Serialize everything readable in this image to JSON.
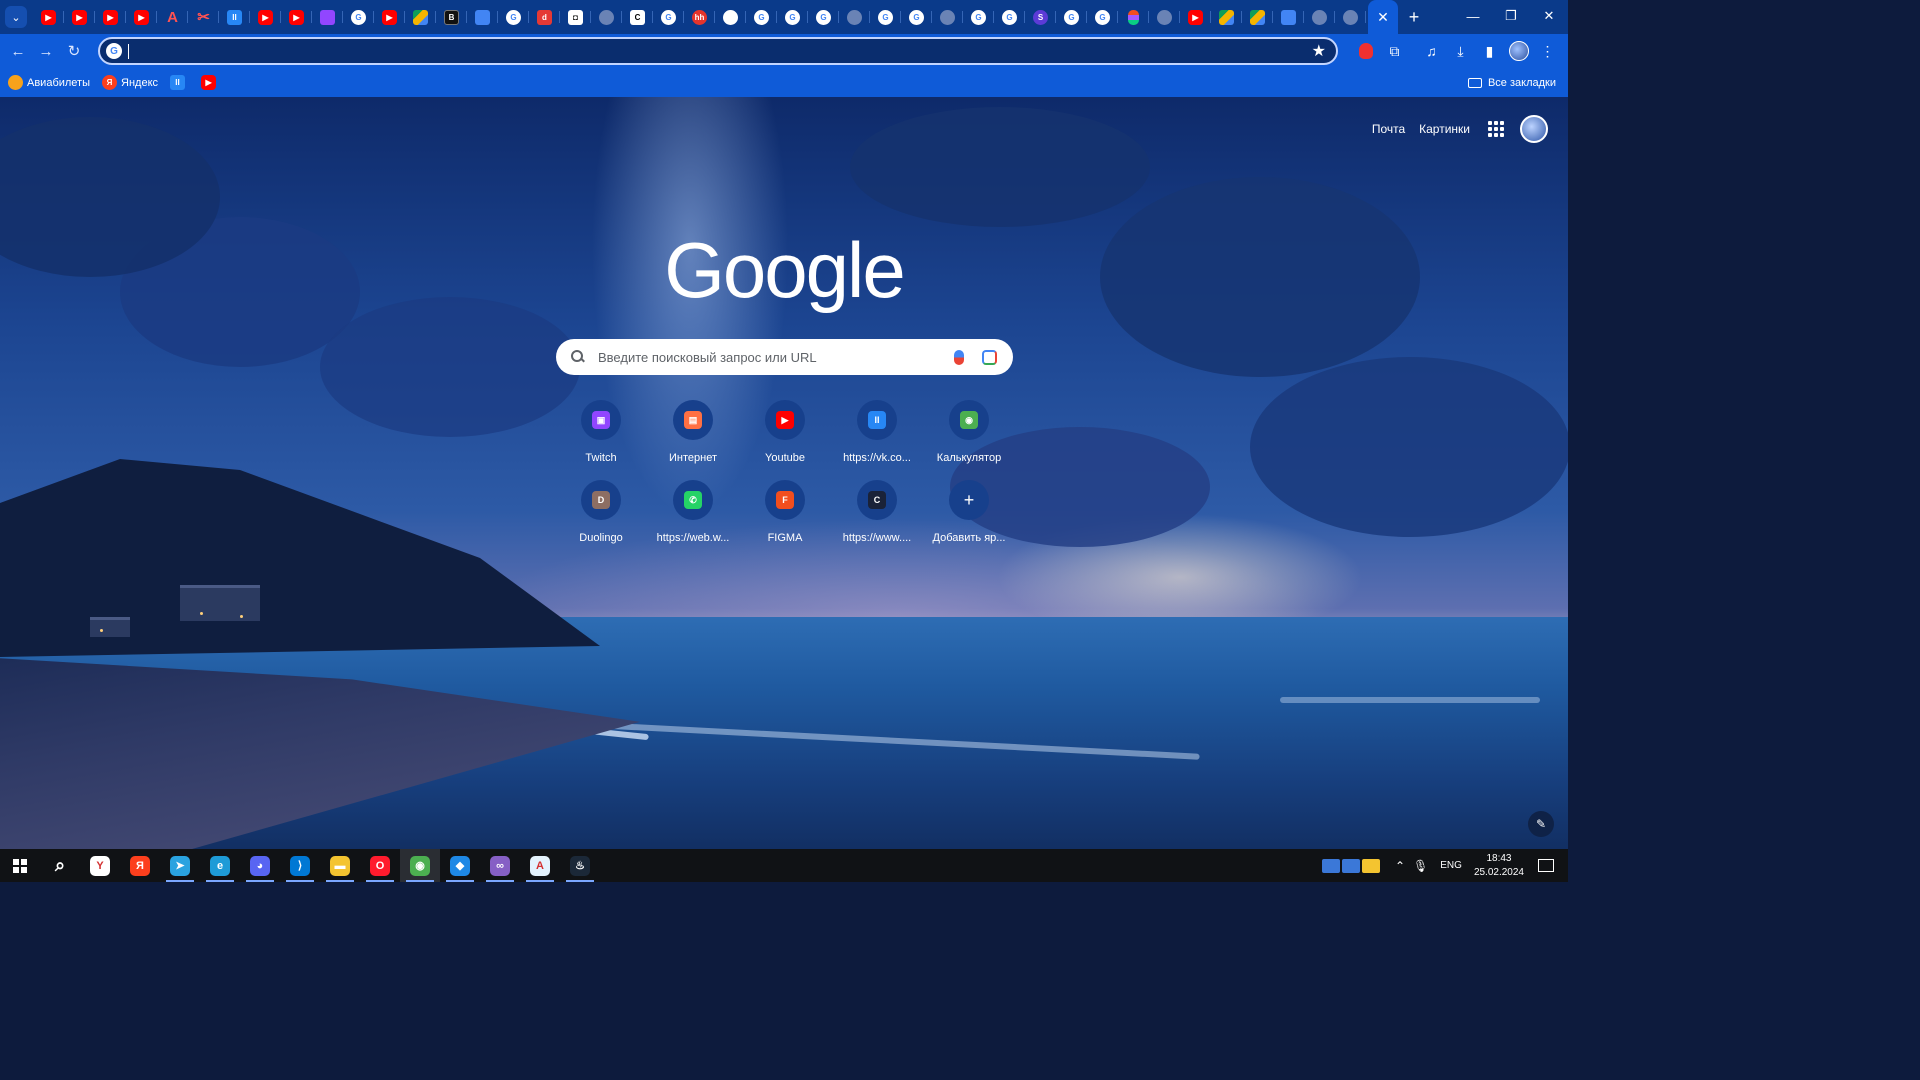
{
  "window": {
    "tabs": [
      {
        "icon": "youtube-icon",
        "type": "yt"
      },
      {
        "icon": "youtube-icon",
        "type": "yt"
      },
      {
        "icon": "youtube-icon",
        "type": "yt"
      },
      {
        "icon": "youtube-icon",
        "type": "yt"
      },
      {
        "icon": "acrobat-icon",
        "type": "a",
        "glyph": "A"
      },
      {
        "icon": "scissors-icon",
        "type": "a",
        "glyph": "✂"
      },
      {
        "icon": "vk-video-icon",
        "type": "vk",
        "glyph": "II"
      },
      {
        "icon": "youtube-icon",
        "type": "yt"
      },
      {
        "icon": "youtube-icon",
        "type": "yt"
      },
      {
        "icon": "twitch-icon",
        "type": "twitch"
      },
      {
        "icon": "google-icon",
        "type": "g",
        "glyph": "G"
      },
      {
        "icon": "youtube-icon",
        "type": "yt"
      },
      {
        "icon": "google-drive-icon",
        "type": "drive"
      },
      {
        "icon": "dark-site-icon",
        "type": "dark",
        "glyph": "B"
      },
      {
        "icon": "google-docs-icon",
        "type": "docs"
      },
      {
        "icon": "google-icon",
        "type": "g",
        "glyph": "G"
      },
      {
        "icon": "dl-icon",
        "type": "red",
        "glyph": "d"
      },
      {
        "icon": "site-icon",
        "type": "white",
        "glyph": "◘"
      },
      {
        "icon": "globe-icon",
        "type": "globe"
      },
      {
        "icon": "c-icon",
        "type": "white",
        "glyph": "C"
      },
      {
        "icon": "google-icon",
        "type": "g",
        "glyph": "G"
      },
      {
        "icon": "hh-icon",
        "type": "hh",
        "glyph": "hh"
      },
      {
        "icon": "github-icon",
        "type": "gh"
      },
      {
        "icon": "google-icon",
        "type": "g",
        "glyph": "G"
      },
      {
        "icon": "google-icon",
        "type": "g",
        "glyph": "G"
      },
      {
        "icon": "google-icon",
        "type": "g",
        "glyph": "G"
      },
      {
        "icon": "globe-icon",
        "type": "globe"
      },
      {
        "icon": "google-icon",
        "type": "g",
        "glyph": "G"
      },
      {
        "icon": "google-icon",
        "type": "g",
        "glyph": "G"
      },
      {
        "icon": "globe-icon",
        "type": "globe"
      },
      {
        "icon": "google-icon",
        "type": "g",
        "glyph": "G"
      },
      {
        "icon": "google-icon",
        "type": "g",
        "glyph": "G"
      },
      {
        "icon": "s-icon",
        "type": "purple",
        "glyph": "S"
      },
      {
        "icon": "google-icon",
        "type": "g",
        "glyph": "G"
      },
      {
        "icon": "google-icon",
        "type": "g",
        "glyph": "G"
      },
      {
        "icon": "figma-icon",
        "type": "figma"
      },
      {
        "icon": "globe-icon",
        "type": "globe"
      },
      {
        "icon": "youtube-icon",
        "type": "yt"
      },
      {
        "icon": "google-drive-icon",
        "type": "drive"
      },
      {
        "icon": "google-drive-icon",
        "type": "drive"
      },
      {
        "icon": "google-docs-icon",
        "type": "docs"
      },
      {
        "icon": "globe-icon",
        "type": "globe"
      },
      {
        "icon": "globe-icon",
        "type": "globe"
      }
    ]
  },
  "omnibox": {
    "value": ""
  },
  "bookmarks": {
    "items": [
      {
        "label": "Авиабилеты",
        "icon": "aviasales-icon"
      },
      {
        "label": "Яндекс",
        "icon": "yandex-icon"
      },
      {
        "label": "",
        "icon": "vk-video-icon"
      },
      {
        "label": "",
        "icon": "youtube-icon"
      }
    ],
    "all_label": "Все закладки"
  },
  "ntp": {
    "links": {
      "mail": "Почта",
      "images": "Картинки"
    },
    "logo": "Google",
    "search_placeholder": "Введите поисковый запрос или URL",
    "shortcuts": [
      {
        "label": "Twitch",
        "icon": "twitch-icon",
        "color": "#9146ff",
        "glyph": "▣"
      },
      {
        "label": "Интернет",
        "icon": "internet-icon",
        "color": "#ff7043",
        "glyph": "▤"
      },
      {
        "label": "Youtube",
        "icon": "youtube-icon",
        "color": "#ff0000",
        "glyph": "▶"
      },
      {
        "label": "https://vk.co...",
        "icon": "vk-video-icon",
        "color": "#2787f5",
        "glyph": "II"
      },
      {
        "label": "Калькулятор",
        "icon": "chrome-icon",
        "color": "#4caf50",
        "glyph": "◉"
      },
      {
        "label": "Duolingo",
        "icon": "duolingo-icon",
        "color": "#8d6e63",
        "glyph": "D"
      },
      {
        "label": "https://web.w...",
        "icon": "whatsapp-icon",
        "color": "#25d366",
        "glyph": "✆"
      },
      {
        "label": "FIGMA",
        "icon": "figma-icon",
        "color": "#f24e1e",
        "glyph": "F"
      },
      {
        "label": "https://www....",
        "icon": "c-icon",
        "color": "#1a2238",
        "glyph": "C"
      },
      {
        "label": "Добавить яр...",
        "icon": "plus-icon",
        "color": "transparent",
        "glyph": "+"
      }
    ]
  },
  "taskbar": {
    "apps": [
      {
        "icon": "search-icon",
        "color": "transparent",
        "glyph": "⌕"
      },
      {
        "icon": "yandex-browser-icon",
        "color": "#ffffff",
        "glyph": "Y"
      },
      {
        "icon": "yandex-icon",
        "color": "#fc3f1d",
        "glyph": "Я"
      },
      {
        "icon": "telegram-icon",
        "color": "#2aa3e0",
        "glyph": "➤"
      },
      {
        "icon": "edge-icon",
        "color": "#1e9bd7",
        "glyph": "e"
      },
      {
        "icon": "discord-icon",
        "color": "#5865f2",
        "glyph": "◕"
      },
      {
        "icon": "vscode-icon",
        "color": "#0078d4",
        "glyph": "⟩"
      },
      {
        "icon": "file-explorer-icon",
        "color": "#f4c430",
        "glyph": "▬"
      },
      {
        "icon": "opera-icon",
        "color": "#ff1b2d",
        "glyph": "O"
      },
      {
        "icon": "chrome-icon",
        "color": "#4caf50",
        "glyph": "◉"
      },
      {
        "icon": "app-icon",
        "color": "#1e88e5",
        "glyph": "◆"
      },
      {
        "icon": "visual-studio-icon",
        "color": "#865fc5",
        "glyph": "∞"
      },
      {
        "icon": "app-store-icon",
        "color": "#e3f2fd",
        "glyph": "A"
      },
      {
        "icon": "steam-icon",
        "color": "#1b2838",
        "glyph": "♨"
      }
    ],
    "lang": "ENG",
    "time": "18:43",
    "date": "25.02.2024"
  }
}
